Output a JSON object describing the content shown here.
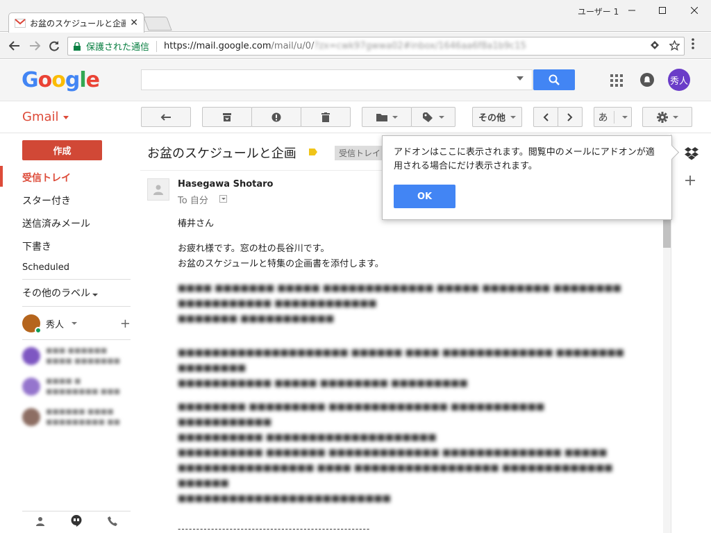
{
  "browser": {
    "tab_title": "お盆のスケジュールと企画 - t",
    "tab_close": "✕",
    "user_label": "ユーザー 1",
    "secure_label": "保護された通信",
    "url_host": "https://mail.google.com",
    "url_path": "/mail/u/0/",
    "url_rest": "?zx=cwk97gwwa02#inbox/1646aa6f8a1b9c15"
  },
  "gmail": {
    "logo": {
      "G": "G",
      "o1": "o",
      "o2": "o",
      "g": "g",
      "l": "l",
      "e": "e"
    },
    "avatar_text": "秀人",
    "app_label": "Gmail",
    "toolbar": {
      "more_label": "その他",
      "input_label": "あ"
    },
    "nav": {
      "compose": "作成",
      "items": [
        "受信トレイ",
        "スター付き",
        "送信済みメール",
        "下書き",
        "Scheduled"
      ],
      "more_labels": "その他のラベル",
      "hangout_user": "秀人"
    },
    "message": {
      "subject": "お盆のスケジュールと企画",
      "inbox_chip": "受信トレイ",
      "sender": "Hasegawa Shotaro",
      "to": "To 自分",
      "greeting": "椿井さん",
      "line1": "お疲れ様です。窓の杜の長谷川です。",
      "line2": "お盆のスケジュールと特集の企画書を添付します。",
      "divider": "----------------------------------------------------"
    },
    "popup": {
      "text": "アドオンはここに表示されます。閲覧中のメールにアドオンが適用される場合にだけ表示されます。",
      "ok": "OK"
    }
  },
  "colors": {
    "accent_blue": "#4285f4",
    "gmail_red": "#dd4b39",
    "compose_red": "#d14836",
    "secure_green": "#0b8043",
    "avatar_purple": "#6a3cc8"
  }
}
